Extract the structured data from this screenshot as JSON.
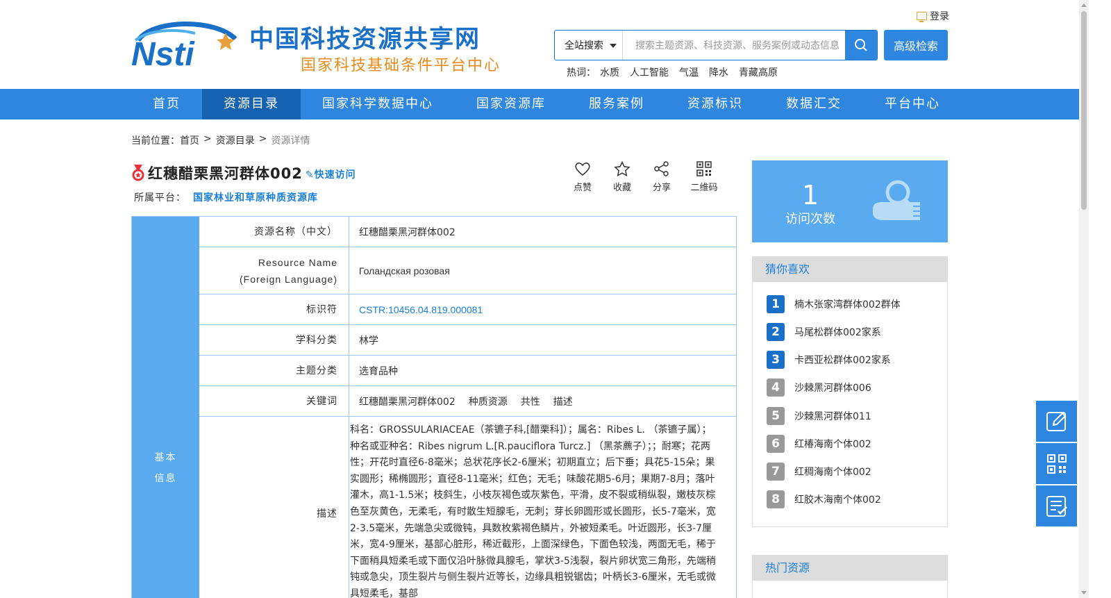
{
  "header": {
    "logo_text": "Nsti",
    "site_title": "中国科技资源共享网",
    "site_subtitle": "国家科技基础条件平台中心",
    "login": "登录",
    "search": {
      "scope": "全站搜索",
      "placeholder": "搜索主题资源、科技资源、服务案例或动态信息",
      "advanced": "高级检索"
    },
    "hot": {
      "label": "热词：",
      "terms": [
        "水质",
        "人工智能",
        "气温",
        "降水",
        "青藏高原"
      ]
    }
  },
  "nav": [
    "首页",
    "资源目录",
    "国家科学数据中心",
    "国家资源库",
    "服务案例",
    "资源标识",
    "数据汇交",
    "平台中心"
  ],
  "breadcrumb": {
    "label": "当前位置：",
    "items": [
      "首页",
      "资源目录"
    ],
    "sep": ">",
    "current": "资源详情"
  },
  "resource": {
    "title": "红穗醋栗黑河群体002",
    "quick_access": "快速访问",
    "platform_label": "所属平台：",
    "platform": "国家林业和草原种质资源库"
  },
  "actions": [
    "点赞",
    "收藏",
    "分享",
    "二维码"
  ],
  "table": {
    "section": [
      "基本",
      "信息"
    ],
    "rows": [
      {
        "key": "资源名称（中文）",
        "value": "红穗醋栗黑河群体002"
      },
      {
        "key_line1": "Resource Name",
        "key_line2": "(Foreign Language)",
        "value": "Голандская розовая"
      },
      {
        "key": "标识符",
        "value": "CSTR:10456.04.819.000081"
      },
      {
        "key": "学科分类",
        "value": "林学"
      },
      {
        "key": "主题分类",
        "value": "选育品种"
      },
      {
        "key": "关键词",
        "keywords": [
          "红穗醋栗黑河群体002",
          "种质资源",
          "共性",
          "描述"
        ]
      },
      {
        "key": "描述",
        "value": "科名：GROSSULARIACEAE（茶镳子科,[醋栗科]）；属名：Ribes L. （茶镳子属）；种名或亚种名：Ribes nigrum L.[R.pauciflora Turcz.] （黑茶藨子）；；耐寒；花两性；开花时直径6-8毫米；总状花序长2-6厘米；初期直立；后下垂；具花5-15朵；果实圆形；稀椭圆形；直径8-11毫米；红色；无毛；味酸花期5-6月；果期7-8月；落叶灌木，高1-1.5米；枝斜生，小枝灰褐色或灰紫色，平滑，皮不裂或稍纵裂，嫩枝灰棕色至灰黄色，无柔毛，有时散生短腺毛，无刺；芽长卵圆形或长圆形，长5-7毫米，宽2-3.5毫米，先端急尖或微钝，具数枚紫褐色鳞片，外被短柔毛。叶近圆形，长3-7厘米，宽4-9厘米，基部心脏形，稀近截形，上面深绿色，下面色较浅，两面无毛，稀于下面稍具短柔毛或下面仅沿叶脉微具腺毛，掌状3-5浅裂，裂片卵状宽三角形，先端稍钝或急尖，顶生裂片与侧生裂片近等长，边缘具粗锐锯齿；叶柄长3-6厘米，无毛或微具短柔毛，基部"
      }
    ]
  },
  "visits": {
    "count": "1",
    "label": "访问次数"
  },
  "recommend": {
    "title": "猜你喜欢",
    "items": [
      "楠木张家湾群体002群体",
      "马尾松群体002家系",
      "卡西亚松群体002家系",
      "沙棘黑河群体006",
      "沙棘黑河群体011",
      "红椿海南个体002",
      "红稠海南个体002",
      "红胶木海南个体002"
    ]
  },
  "hot_resources": {
    "title": "热门资源"
  },
  "colors": {
    "primary": "#2e86de",
    "nav_active": "#1462b0",
    "link": "#1a7fd8",
    "accent": "#e88a1a",
    "panel": "#5aaaf0"
  }
}
